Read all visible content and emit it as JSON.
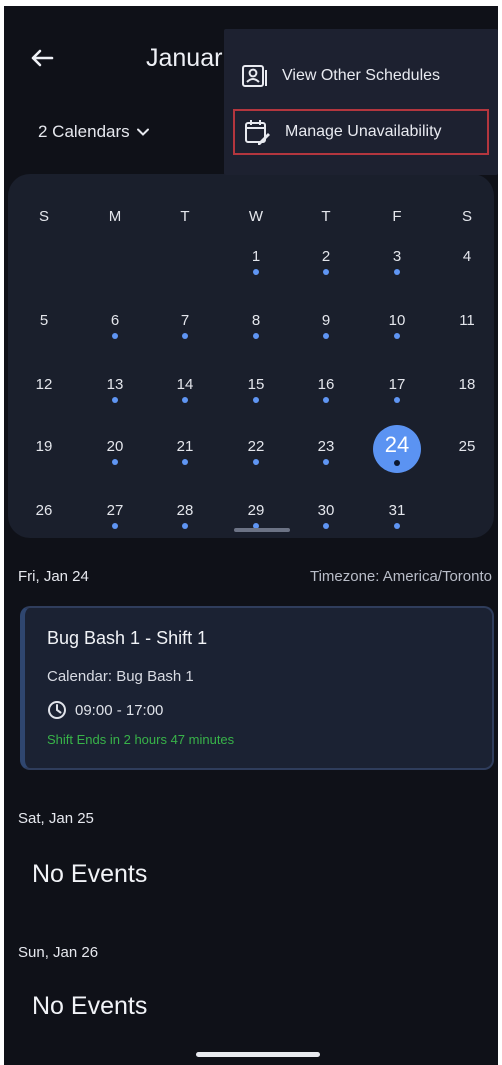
{
  "header": {
    "title": "Januar",
    "calendars_selector": "2 Calendars"
  },
  "menu": {
    "items": [
      {
        "label": "View Other Schedules",
        "icon": "person-card-icon"
      },
      {
        "label": "Manage Unavailability",
        "icon": "calendar-edit-icon"
      }
    ]
  },
  "calendar": {
    "weekdays": [
      "S",
      "M",
      "T",
      "W",
      "T",
      "F",
      "S"
    ],
    "weeks": [
      [
        {
          "d": ""
        },
        {
          "d": ""
        },
        {
          "d": ""
        },
        {
          "d": "1",
          "dot": true
        },
        {
          "d": "2",
          "dot": true
        },
        {
          "d": "3",
          "dot": true
        },
        {
          "d": "4"
        }
      ],
      [
        {
          "d": "5"
        },
        {
          "d": "6",
          "dot": true
        },
        {
          "d": "7",
          "dot": true
        },
        {
          "d": "8",
          "dot": true
        },
        {
          "d": "9",
          "dot": true
        },
        {
          "d": "10",
          "dot": true
        },
        {
          "d": "11"
        }
      ],
      [
        {
          "d": "12"
        },
        {
          "d": "13",
          "dot": true
        },
        {
          "d": "14",
          "dot": true
        },
        {
          "d": "15",
          "dot": true
        },
        {
          "d": "16",
          "dot": true
        },
        {
          "d": "17",
          "dot": true
        },
        {
          "d": "18"
        }
      ],
      [
        {
          "d": "19"
        },
        {
          "d": "20",
          "dot": true
        },
        {
          "d": "21",
          "dot": true
        },
        {
          "d": "22",
          "dot": true
        },
        {
          "d": "23",
          "dot": true
        },
        {
          "d": "24",
          "dot": true,
          "selected": true
        },
        {
          "d": "25"
        }
      ],
      [
        {
          "d": "26"
        },
        {
          "d": "27",
          "dot": true
        },
        {
          "d": "28",
          "dot": true
        },
        {
          "d": "29",
          "dot": true
        },
        {
          "d": "30",
          "dot": true
        },
        {
          "d": "31",
          "dot": true
        },
        {
          "d": ""
        }
      ]
    ]
  },
  "days": [
    {
      "header": "Fri, Jan 24",
      "timezone": "Timezone: America/Toronto"
    },
    {
      "header": "Sat, Jan 25",
      "empty": "No Events"
    },
    {
      "header": "Sun, Jan 26",
      "empty": "No Events"
    }
  ],
  "event": {
    "title": "Bug Bash 1 - Shift 1",
    "calendar": "Calendar: Bug Bash 1",
    "time": "09:00 - 17:00",
    "status": "Shift Ends in 2 hours 47 minutes"
  },
  "colors": {
    "background": "#0f1118",
    "accent": "#5b93f2",
    "status_green": "#38b349",
    "highlight_border": "#b3363e"
  }
}
